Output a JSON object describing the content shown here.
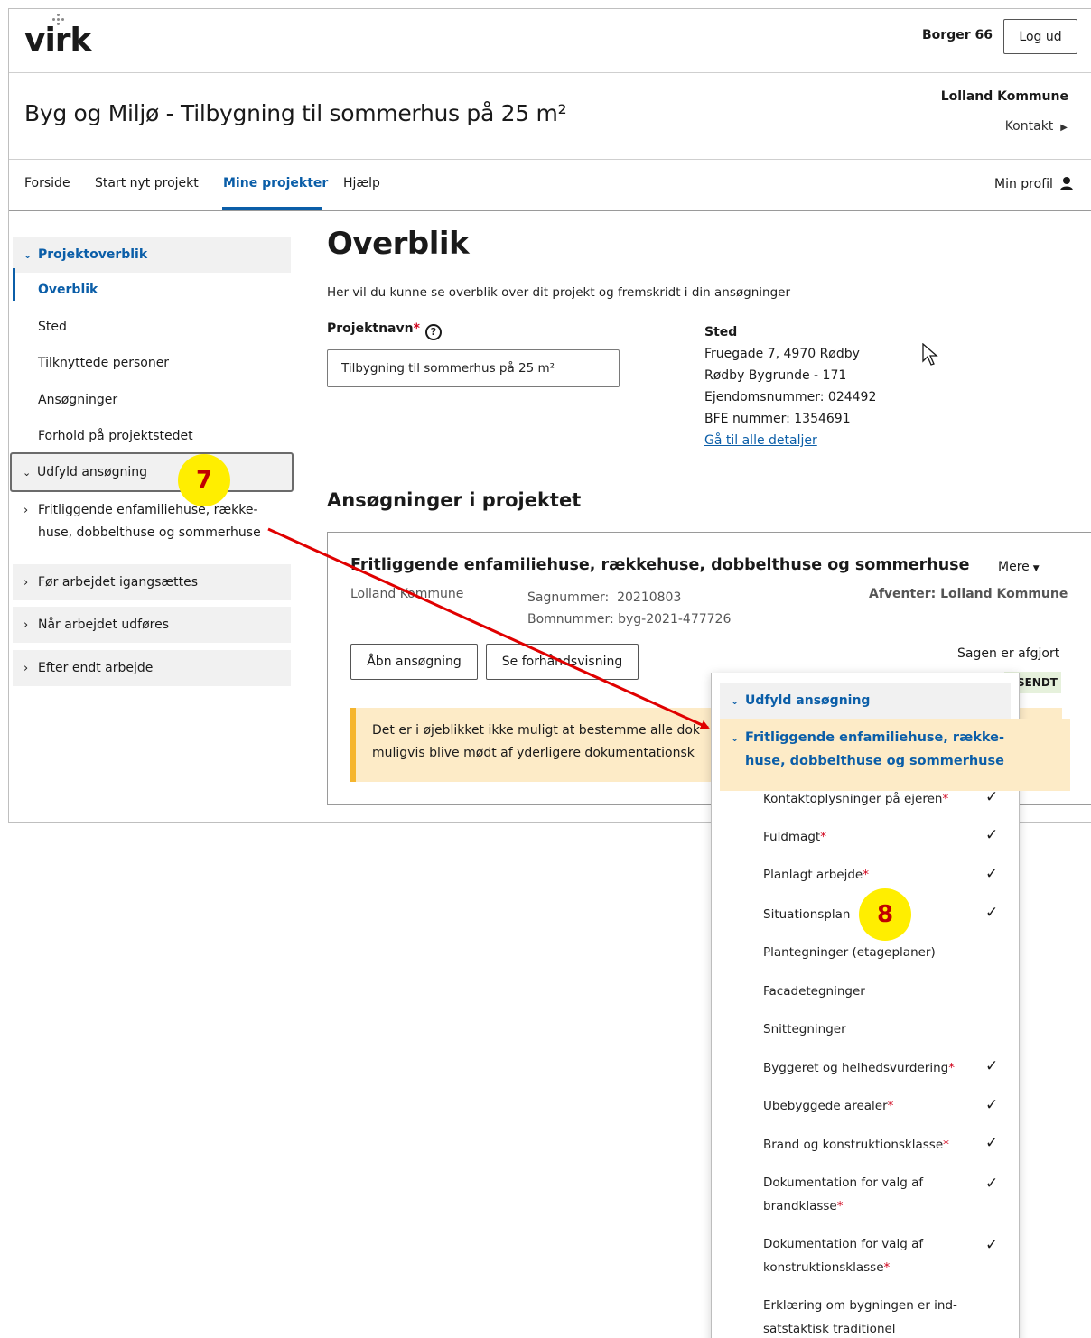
{
  "header": {
    "logo": "virk",
    "user": "Borger 66",
    "logout_label": "Log ud"
  },
  "titlebar": {
    "title": "Byg og Miljø - Tilbygning til sommerhus på 25 m²",
    "municipality": "Lolland Kommune",
    "contact": "Kontakt"
  },
  "nav": {
    "items": [
      "Forside",
      "Start nyt projekt",
      "Mine projekter",
      "Hjælp"
    ],
    "active": "Mine projekter",
    "profile": "Min profil"
  },
  "sidebar": {
    "group_overview": "Projektoverblik",
    "items": [
      "Overblik",
      "Sted",
      "Tilknyttede personer",
      "Ansøgninger",
      "Forhold på projektstedet"
    ],
    "group_fill": "Udfyld ansøgning",
    "sub_item_line1": "Fritliggende enfamiliehuse, række-",
    "sub_item_line2": "huse, dobbelthuse og sommerhuse",
    "group_before": "Før arbejdet igangsættes",
    "group_during": "Når arbejdet udføres",
    "group_after": "Efter endt arbejde"
  },
  "main": {
    "heading": "Overblik",
    "intro": "Her vil du kunne se overblik over dit projekt og fremskridt i din ansøgninger",
    "project_label": "Projektnavn",
    "project_value": "Tilbygning til sommerhus på 25 m²",
    "sted_label": "Sted",
    "sted_lines": [
      "Fruegade 7, 4970 Rødby",
      "Rødby Bygrunde - 171",
      "Ejendomsnummer: 024492",
      "BFE nummer: 1354691"
    ],
    "sted_link": "Gå til alle detaljer",
    "applications_heading": "Ansøgninger i projektet"
  },
  "card": {
    "title": "Fritliggende enfamiliehuse, rækkehuse, dobbelthuse og sommerhuse",
    "more": "Mere",
    "municipality": "Lolland Kommune",
    "case_number": "Sagnummer:  20210803",
    "bom_number": "Bomnummer: byg-2021-477726",
    "awaiting": "Afventer: Lolland Kommune",
    "open_button": "Åbn ansøgning",
    "preview_button": "Se forhåndsvisning",
    "status": "Sagen er afgjort",
    "badge": "DSENDT",
    "warning_line1": "Det er i øjeblikket ikke muligt at bestemme alle dok",
    "warning_line2": "muligvis blive mødt af yderligere dokumentationsk"
  },
  "panel": {
    "head": "Udfyld ansøgning",
    "sub_line1": "Fritliggende enfamiliehuse, række-",
    "sub_line2": "huse, dobbelthuse og sommerhuse",
    "items": [
      {
        "label": "Kontaktoplysninger på ejeren",
        "required": "*",
        "done": true
      },
      {
        "label": "Fuldmagt",
        "required": "*",
        "done": true
      },
      {
        "label": "Planlagt arbejde",
        "required": "*",
        "done": true
      },
      {
        "label": "Situationsplan",
        "required": "",
        "done": true
      },
      {
        "label": "Plantegninger (etageplaner)",
        "required": "",
        "done": false
      },
      {
        "label": "Facadetegninger",
        "required": "",
        "done": false
      },
      {
        "label": "Snittegninger",
        "required": "",
        "done": false
      },
      {
        "label": "Byggeret og helhedsvurdering",
        "required": "*",
        "done": true
      },
      {
        "label": "Ubebyggede arealer",
        "required": "*",
        "done": true
      },
      {
        "label": "Brand og konstruktionsklasse",
        "required": "*",
        "done": true
      }
    ],
    "item_doc_brand_line1": "Dokumentation for valg af",
    "item_doc_brand_line2": "brandklasse",
    "item_doc_konst_line1": "Dokumentation for valg af",
    "item_doc_konst_line2": "konstruktionsklasse",
    "item_erkl_line1": "Erklæring om bygningen er ind-",
    "item_erkl_line2": "satstaktisk traditionel",
    "required_mark": "*",
    "check": "✓"
  },
  "annotations": {
    "badge7": "7",
    "badge8": "8",
    "arrow_color": "#e00000",
    "badge_color": "#ffee00"
  }
}
